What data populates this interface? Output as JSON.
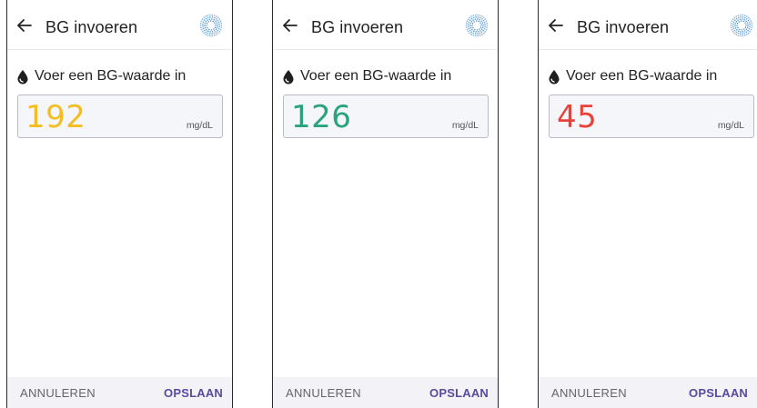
{
  "screens": [
    {
      "title": "BG invoeren",
      "prompt": "Voer een BG-waarde in",
      "value": "192",
      "value_color": "#f5bd1f",
      "unit": "mg/dL",
      "cancel_label": "ANNULEREN",
      "save_label": "OPSLAAN"
    },
    {
      "title": "BG invoeren",
      "prompt": "Voer een BG-waarde in",
      "value": "126",
      "value_color": "#2aa37c",
      "unit": "mg/dL",
      "cancel_label": "ANNULEREN",
      "save_label": "OPSLAAN"
    },
    {
      "title": "BG invoeren",
      "prompt": "Voer een BG-waarde in",
      "value": "45",
      "value_color": "#e8423a",
      "unit": "mg/dL",
      "cancel_label": "ANNULEREN",
      "save_label": "OPSLAAN"
    }
  ],
  "icons": {
    "back": "arrow-left-icon",
    "logo": "dotted-ring-logo-icon",
    "drop": "blood-drop-icon"
  },
  "colors": {
    "accent": "#5b4a9e",
    "logo_dots": "#3a86c8"
  }
}
